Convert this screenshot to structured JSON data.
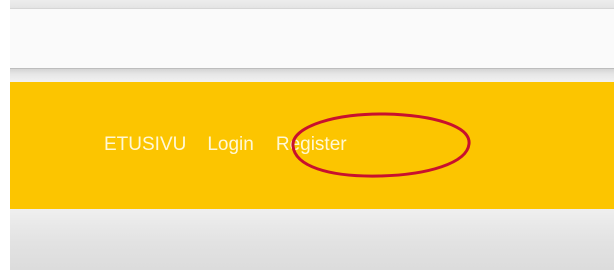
{
  "nav": {
    "items": [
      {
        "label": "ETUSIVU"
      },
      {
        "label": "Login"
      },
      {
        "label": "Register"
      }
    ]
  },
  "colors": {
    "nav_background": "#fcc500",
    "nav_text": "#fff8d6",
    "highlight_stroke": "#c8102e"
  },
  "annotation": {
    "highlighted_item": "Register"
  }
}
